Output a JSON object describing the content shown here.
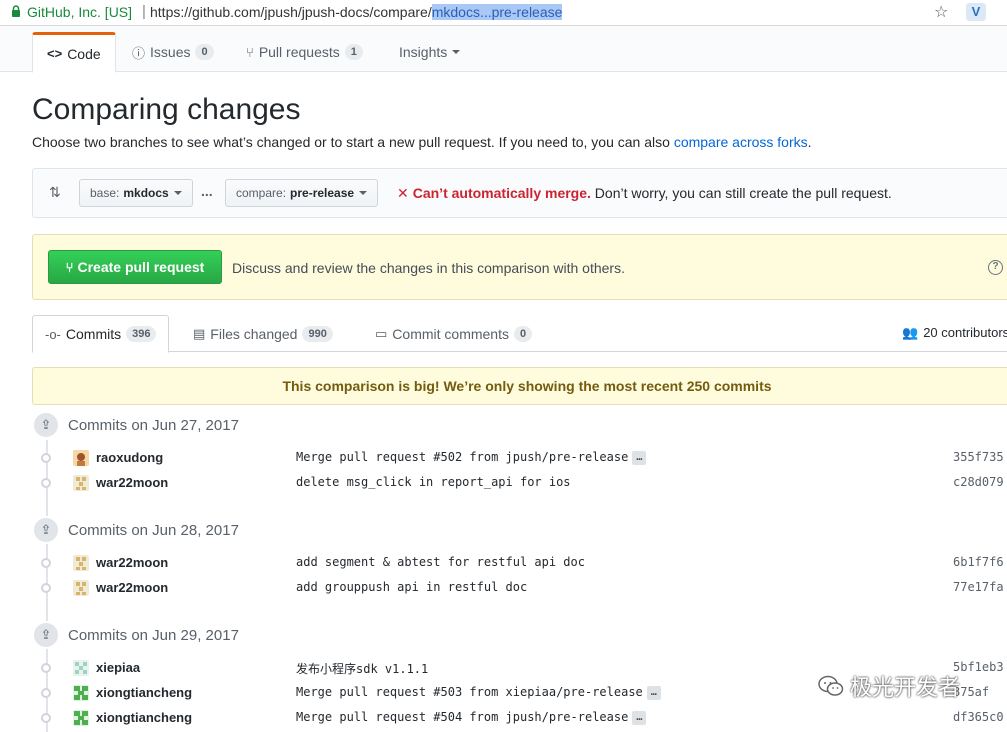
{
  "browser": {
    "secure_label": "GitHub, Inc. [US]",
    "url_prefix": "https://github.com/jpush/jpush-docs/compare/",
    "url_selected": "mkdocs...pre-release",
    "star_icon": "bookmark-star-icon",
    "extension_label": "V"
  },
  "repo_nav": {
    "code": "Code",
    "issues": "Issues",
    "issues_count": "0",
    "pulls": "Pull requests",
    "pulls_count": "1",
    "insights": "Insights"
  },
  "page": {
    "title": "Comparing changes",
    "subtitle": "Choose two branches to see what’s changed or to start a new pull request. If you need to, you can also",
    "subtitle_link": "compare across forks",
    "subtitle_end": "."
  },
  "range": {
    "base_prefix": "base:",
    "base_branch": "mkdocs",
    "dots": "...",
    "compare_prefix": "compare:",
    "compare_branch": "pre-release",
    "merge_status": "Can’t automatically merge.",
    "merge_note": "Don’t worry, you can still create the pull request."
  },
  "pr": {
    "button": "Create pull request",
    "description": "Discuss and review the changes in this comparison with others.",
    "help": "?"
  },
  "tabs": {
    "commits": "Commits",
    "commits_count": "396",
    "files": "Files changed",
    "files_count": "990",
    "comments": "Commit comments",
    "comments_count": "0",
    "contributors": "20 contributors"
  },
  "flash": "This comparison is big! We’re only showing the most recent 250 commits",
  "groups": [
    {
      "date": "Commits on Jun 27, 2017",
      "commits": [
        {
          "author": "raoxudong",
          "message": "Merge pull request #502 from jpush/pre-release",
          "sha": "355f735",
          "ellipsis": true
        },
        {
          "author": "war22moon",
          "message": "delete msg_click in report_api for ios",
          "sha": "c28d079",
          "ellipsis": false
        }
      ]
    },
    {
      "date": "Commits on Jun 28, 2017",
      "commits": [
        {
          "author": "war22moon",
          "message": "add segment & abtest for restful api doc",
          "sha": "6b1f7f6",
          "ellipsis": false
        },
        {
          "author": "war22moon",
          "message": "add grouppush api in restful doc",
          "sha": "77e17fa",
          "ellipsis": false
        }
      ]
    },
    {
      "date": "Commits on Jun 29, 2017",
      "commits": [
        {
          "author": "xiepiaa",
          "message": "发布小程序sdk v1.1.1",
          "sha": "5bf1eb3",
          "ellipsis": false
        },
        {
          "author": "xiongtiancheng",
          "message": "Merge pull request #503 from xiepiaa/pre-release",
          "sha": "875af",
          "ellipsis": true
        },
        {
          "author": "xiongtiancheng",
          "message": "Merge pull request #504 from jpush/pre-release",
          "sha": "df365c0",
          "ellipsis": true
        }
      ]
    }
  ],
  "ellipsis_label": "…",
  "watermark": "极光开发者"
}
